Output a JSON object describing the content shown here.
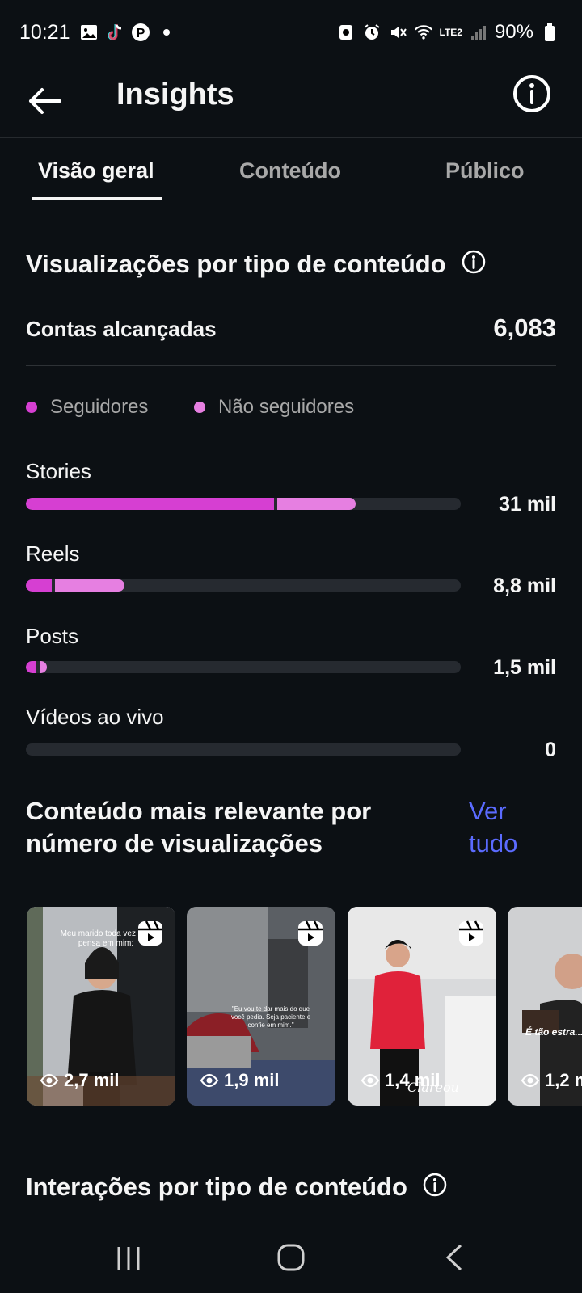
{
  "status_bar": {
    "time": "10:21",
    "battery": "90%",
    "network": "LTE2"
  },
  "header": {
    "title": "Insights"
  },
  "tabs": [
    {
      "label": "Visão geral",
      "active": true
    },
    {
      "label": "Conteúdo",
      "active": false
    },
    {
      "label": "Público",
      "active": false
    }
  ],
  "views_section": {
    "title": "Visualizações por tipo de conteúdo",
    "reach_label": "Contas alcançadas",
    "reach_value": "6,083",
    "legend": [
      {
        "label": "Seguidores",
        "color": "#d63fd2"
      },
      {
        "label": "Não seguidores",
        "color": "#e67fe1"
      }
    ],
    "bars": [
      {
        "label": "Stories",
        "value": "31 mil",
        "followers_fraction": 0.57,
        "non_followers_fraction": 0.18
      },
      {
        "label": "Reels",
        "value": "8,8 mil",
        "followers_fraction": 0.06,
        "non_followers_fraction": 0.16
      },
      {
        "label": "Posts",
        "value": "1,5 mil",
        "followers_fraction": 0.025,
        "non_followers_fraction": 0.016
      },
      {
        "label": "Vídeos ao vivo",
        "value": "0",
        "followers_fraction": 0,
        "non_followers_fraction": 0
      }
    ]
  },
  "top_content": {
    "title_line1": "Conteúdo mais relevante por",
    "title_line2": "número de visualizações",
    "see_all_line1": "Ver",
    "see_all_line2": "tudo",
    "cards": [
      {
        "views": "2,7 mil",
        "overlay": "Meu marido toda vez que pensa em mim:"
      },
      {
        "views": "1,9 mil",
        "overlay": "\"Eu vou te dar mais do que você pedia. Seja paciente e confie em mim.\""
      },
      {
        "views": "1,4 mil",
        "overlay": "Clareou"
      },
      {
        "views": "1,2 mil",
        "overlay": "É tão estra... foto antig..."
      }
    ]
  },
  "interactions_section": {
    "title": "Interações por tipo de conteúdo"
  },
  "colors": {
    "followers": "#d63fd2",
    "non_followers": "#e67fe1",
    "link": "#5b6bff",
    "background": "#0c1014"
  }
}
